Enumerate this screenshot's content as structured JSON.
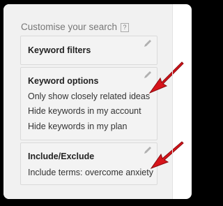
{
  "heading": "Customise your search",
  "help_glyph": "?",
  "cards": {
    "keyword_filters": {
      "title": "Keyword filters"
    },
    "keyword_options": {
      "title": "Keyword options",
      "lines": [
        "Only show closely related ideas",
        "Hide keywords in my account",
        "Hide keywords in my plan"
      ]
    },
    "include_exclude": {
      "title": "Include/Exclude",
      "lines": [
        "Include terms: overcome anxiety"
      ]
    }
  },
  "icons": {
    "edit": "pencil-icon",
    "annotation": "red-arrow-icon"
  },
  "colors": {
    "panel_bg": "#f1f1f1",
    "card_bg": "#f3f3f3",
    "arrow_red": "#d7141b",
    "outer_bg": "#000000"
  }
}
